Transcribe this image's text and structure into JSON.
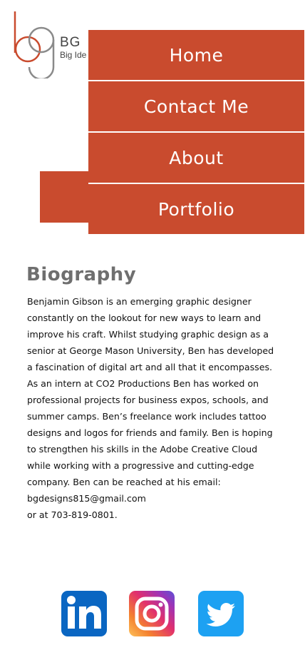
{
  "header": {
    "logo_mark": "bg",
    "logo_initials": "BG",
    "logo_name": "Big Idea"
  },
  "nav": {
    "items": [
      {
        "label": "Home"
      },
      {
        "label": "Contact Me"
      },
      {
        "label": "About"
      },
      {
        "label": "Portfolio"
      }
    ]
  },
  "biography": {
    "title": "Biography",
    "text": "Benjamin Gibson is an emerging graphic designer constantly on the lookout for new ways to learn and improve his craft. Whilst studying graphic design as a senior at George Mason University, Ben has developed a fascination of digital art and all that it encompasses. As an intern at CO2 Productions Ben has worked on professional projects for business expos, schools, and summer camps. Ben’s freelance work includes tattoo designs and logos for friends and family. Ben is hoping to strengthen his skills in the Adobe Creative Cloud while working with a progressive and cutting-edge company. Ben can be reached at his email: bgdesigns815@gmail.com",
    "phone_line": "or at 703-819-0801."
  },
  "social": {
    "linkedin_icon": "linkedin-icon",
    "instagram_icon": "instagram-icon",
    "twitter_icon": "twitter-icon"
  },
  "colors": {
    "accent": "#c94b2e",
    "title_gray": "#6f6f6f",
    "linkedin": "#0a66c2",
    "twitter": "#1da1f2"
  }
}
